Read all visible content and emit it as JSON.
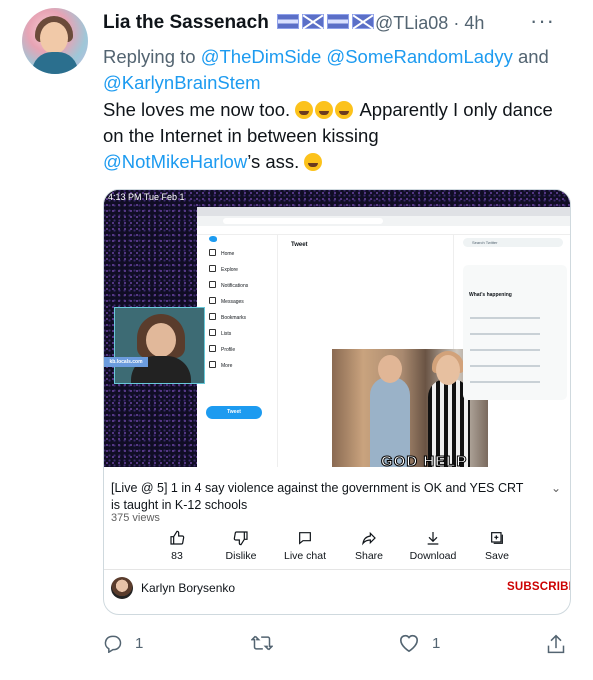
{
  "tweet": {
    "author_name": "Lia the Sassenach",
    "handle": "@TLia08",
    "separator": "·",
    "time": "4h",
    "more_icon": "more-dots-icon",
    "reply_prefix": "Replying to",
    "reply_to": [
      "@TheDimSide",
      "@SomeRandomLadyy"
    ],
    "reply_and": "and",
    "reply_to_last": "@KarlynBrainStem",
    "text_part1": "She loves me now too.",
    "text_part2": "Apparently I only dance on the Internet in between kissing",
    "mention": "@NotMikeHarlow",
    "text_part3": "’s ass.",
    "emoji_name": "grinning-sweat-emoji"
  },
  "video": {
    "time_overlay": "4:13 PM  Tue Feb 1",
    "embedded_tweet_header": "Tweet",
    "embedded_search": "Search Twitter",
    "embedded_happening": "What's happening",
    "embedded_tweet_button": "Tweet",
    "embedded_nav": [
      "Home",
      "Explore",
      "Notifications",
      "Messages",
      "Bookmarks",
      "Lists",
      "Profile",
      "More"
    ],
    "gif_caption": "GOD HELP US ALL",
    "webcam_label": "kb.locals.com",
    "title": "[Live @ 5] 1 in 4 say violence against the government is OK and YES CRT is taught in K-12 schools",
    "views": "375 views",
    "actions": [
      {
        "label": "83",
        "icon": "thumbs-up-icon"
      },
      {
        "label": "Dislike",
        "icon": "thumbs-down-icon"
      },
      {
        "label": "Live chat",
        "icon": "chat-icon"
      },
      {
        "label": "Share",
        "icon": "share-icon"
      },
      {
        "label": "Download",
        "icon": "download-icon"
      },
      {
        "label": "Save",
        "icon": "save-icon"
      }
    ],
    "channel_name": "Karlyn Borysenko",
    "subscribe_label": "SUBSCRIBE"
  },
  "tweet_actions": {
    "reply_count": "1",
    "retweet_count": "",
    "like_count": "1",
    "icons": [
      "reply-icon",
      "retweet-icon",
      "like-icon",
      "share-icon"
    ]
  },
  "colors": {
    "link": "#1d9bf0",
    "subscribe": "#cc0000",
    "muted": "#536471"
  }
}
